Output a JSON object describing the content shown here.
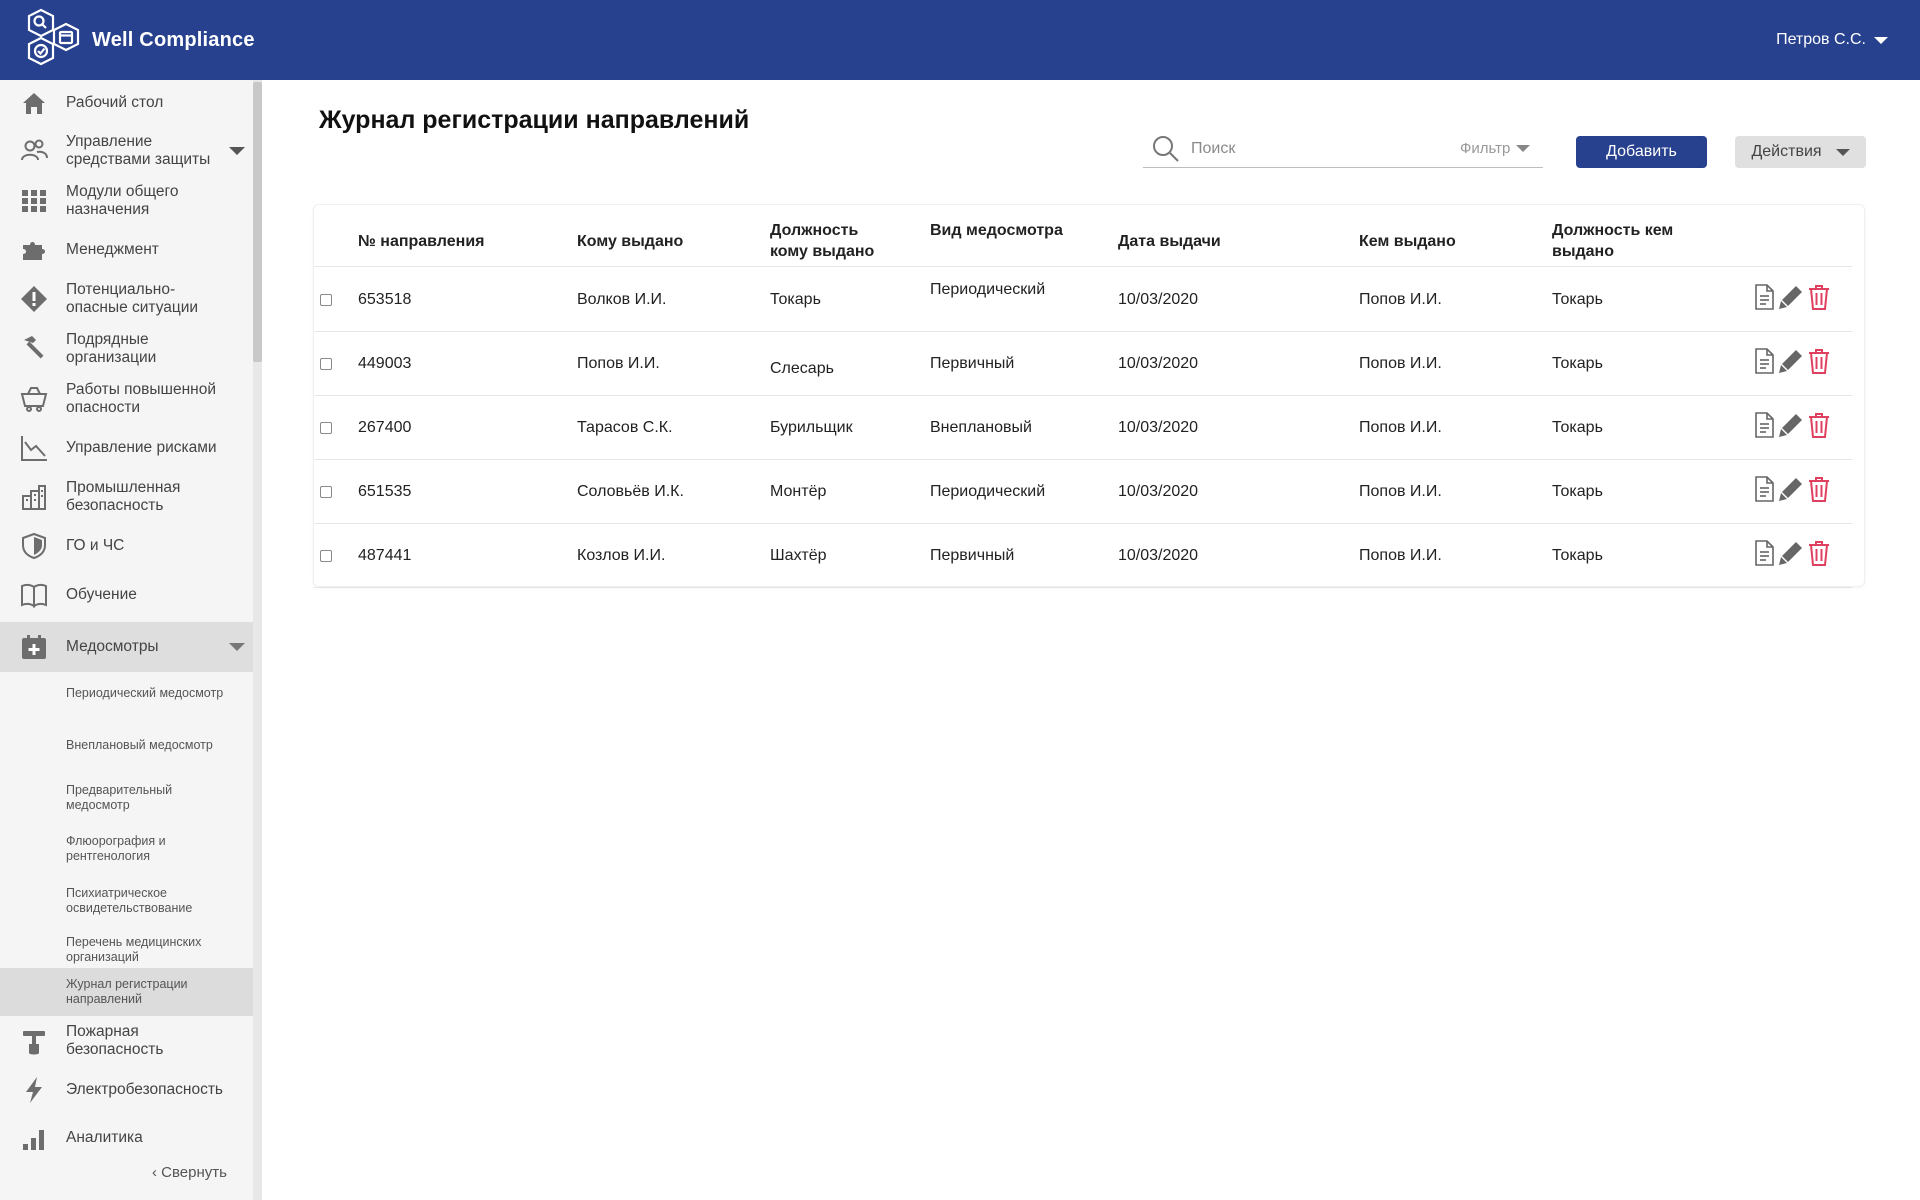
{
  "header": {
    "brand": "Well Compliance",
    "user": "Петров С.С."
  },
  "sidebar": {
    "items": [
      {
        "label": "Рабочий стол"
      },
      {
        "label": "Управление средствами защиты"
      },
      {
        "label": "Модули общего назначения"
      },
      {
        "label": "Менеджмент"
      },
      {
        "label": "Потенциально-опасные ситуации"
      },
      {
        "label": "Подрядные организации"
      },
      {
        "label": "Работы повышенной опасности"
      },
      {
        "label": "Управление рисками"
      },
      {
        "label": "Промышленная безопасность"
      },
      {
        "label": "ГО и ЧС"
      },
      {
        "label": "Обучение"
      },
      {
        "label": "Медосмотры"
      },
      {
        "label": "Пожарная безопасность"
      },
      {
        "label": "Электробезопасность"
      },
      {
        "label": "Аналитика"
      }
    ],
    "subitems": [
      {
        "label": "Периодический медосмотр"
      },
      {
        "label": "Внеплановый медосмотр"
      },
      {
        "label": "Предварительный медосмотр"
      },
      {
        "label": "Флюорография и рентгенология"
      },
      {
        "label": "Психиатрическое освидетельствование"
      },
      {
        "label": "Перечень медицинских организаций"
      },
      {
        "label": "Журнал регистрации направлений"
      }
    ],
    "collapse": "‹ Свернуть"
  },
  "main": {
    "title": "Журнал регистрации направлений",
    "search_placeholder": "Поиск",
    "filter_label": "Фильтр",
    "add_label": "Добавить",
    "actions_label": "Действия"
  },
  "table": {
    "columns": [
      "№ направления",
      "Кому выдано",
      "Должность кому выдано",
      "Вид медосмотра",
      "Дата выдачи",
      "Кем выдано",
      "Должность кем выдано"
    ],
    "rows": [
      {
        "id": "653518",
        "to": "Волков И.И.",
        "to_pos": "Токарь",
        "type": "Периодический",
        "date": "10/03/2020",
        "by": "Попов И.И.",
        "by_pos": "Токарь"
      },
      {
        "id": "449003",
        "to": "Попов И.И.",
        "to_pos": "Слесарь",
        "type": "Первичный",
        "date": "10/03/2020",
        "by": "Попов И.И.",
        "by_pos": "Токарь"
      },
      {
        "id": "267400",
        "to": "Тарасов С.К.",
        "to_pos": "Бурильщик",
        "type": "Внеплановый",
        "date": "10/03/2020",
        "by": "Попов И.И.",
        "by_pos": "Токарь"
      },
      {
        "id": "651535",
        "to": "Соловьёв И.К.",
        "to_pos": "Монтёр",
        "type": "Периодический",
        "date": "10/03/2020",
        "by": "Попов И.И.",
        "by_pos": "Токарь"
      },
      {
        "id": "487441",
        "to": "Козлов И.И.",
        "to_pos": "Шахтёр",
        "type": "Первичный",
        "date": "10/03/2020",
        "by": "Попов И.И.",
        "by_pos": "Токарь"
      }
    ]
  },
  "icons": {
    "view": "document-icon",
    "edit": "pencil-icon",
    "delete": "trash-icon"
  },
  "colors": {
    "header": "#27418e",
    "primary_button": "#27418e",
    "delete_icon": "#e04060"
  }
}
